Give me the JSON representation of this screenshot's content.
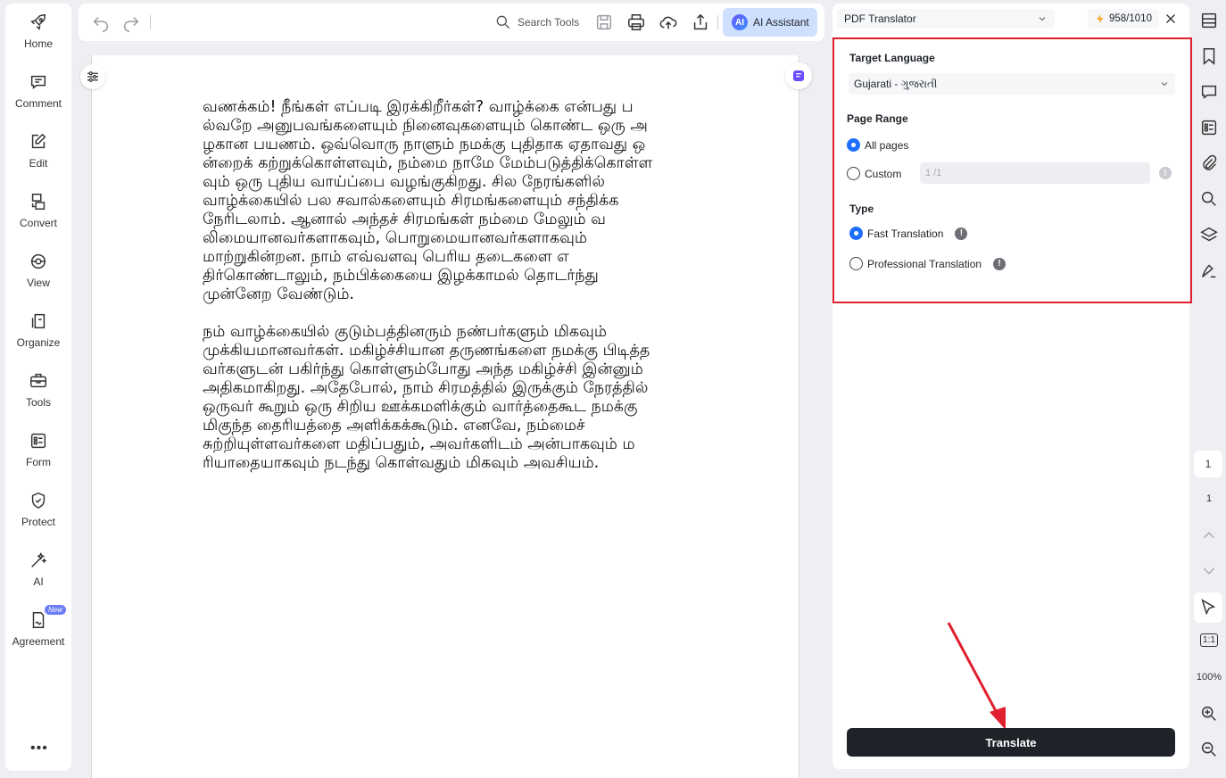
{
  "sidebar": {
    "items": [
      {
        "label": "Home",
        "icon": "rocket-icon"
      },
      {
        "label": "Comment",
        "icon": "comment-icon"
      },
      {
        "label": "Edit",
        "icon": "edit-icon"
      },
      {
        "label": "Convert",
        "icon": "convert-icon"
      },
      {
        "label": "View",
        "icon": "view-icon"
      },
      {
        "label": "Organize",
        "icon": "organize-icon"
      },
      {
        "label": "Tools",
        "icon": "toolbox-icon"
      },
      {
        "label": "Form",
        "icon": "form-icon"
      },
      {
        "label": "Protect",
        "icon": "shield-icon"
      },
      {
        "label": "AI",
        "icon": "magic-wand-icon"
      },
      {
        "label": "Agreement",
        "icon": "agreement-icon",
        "badge": "New"
      }
    ],
    "more": "•••"
  },
  "toolbar": {
    "search_label": "Search Tools",
    "ai_badge": "AI",
    "ai_assistant_label": "AI Assistant"
  },
  "document": {
    "paragraphs": [
      "வணக்கம்! நீங்கள் எப்படி இரக்கிறீர்கள்? வாழ்க்கை என்பது பல்வறே அனுபவங்களையும் நினைவுகளையும் கொண்ட ஒரு அழகான பயணம். ஒவ்வொரு நாளும் நமக்கு புதிதாக ஏதாவது ஒன்றைக் கற்றுக்கொள்ளவும், நம்மை நாமே மேம்படுத்திக்கொள்ளவும் ஒரு புதிய வாய்ப்பை வழங்குகிறது. சில நேரங்களில் வாழ்க்கையில் பல சவால்களையும் சிரமங்களையும் சந்திக்க நேரிடலாம். ஆனால் அந்தச் சிரமங்கள் நம்மை மேலும் வலிமையானவர்களாகவும், பொறுமையானவர்களாகவும் மாற்றுகின்றன. நாம் எவ்வளவு பெரிய தடைகளை எதிர்கொண்டாலும், நம்பிக்கையை இழக்காமல் தொடர்ந்து முன்னேற வேண்டும்.",
      "நம் வாழ்க்கையில் குடும்பத்தினரும் நண்பர்களும் மிகவும் முக்கியமானவர்கள். மகிழ்ச்சியான தருணங்களை நமக்கு பிடித்தவர்களுடன் பகிர்ந்து கொள்ளும்போது அந்த மகிழ்ச்சி இன்னும் அதிகமாகிறது. அதேபோல், நாம் சிரமத்தில் இருக்கும் நேரத்தில் ஒருவர் கூறும் ஒரு சிறிய ஊக்கமளிக்கும் வார்த்தைகூட நமக்கு மிகுந்த தைரியத்தை அளிக்கக்கூடும். எனவே, நம்மைச் சுற்றியுள்ளவர்களை மதிப்பதும், அவர்களிடம் அன்பாகவும் மரியாதையாகவும் நடந்து கொள்வதும் மிகவும் அவசியம்."
    ]
  },
  "panel": {
    "tool_name": "PDF Translator",
    "credits": "958/1010",
    "target_language_label": "Target Language",
    "target_language_value": "Gujarati - ગુજરાતી",
    "page_range_label": "Page Range",
    "all_pages_label": "All pages",
    "custom_label": "Custom",
    "custom_placeholder": "1 /1",
    "type_label": "Type",
    "fast_translation_label": "Fast Translation",
    "professional_translation_label": "Professional Translation",
    "translate_button": "Translate",
    "selected_page_range": "All pages",
    "selected_type": "Fast Translation"
  },
  "rail": {
    "current_page": "1",
    "total_pages": "1",
    "fit_label": "1:1",
    "zoom": "100%"
  },
  "colors": {
    "accent": "#1f6fff",
    "highlight_border": "#e0202e",
    "translate_button_bg": "#1f2329",
    "ai_button_bg": "#cfe0ff"
  }
}
